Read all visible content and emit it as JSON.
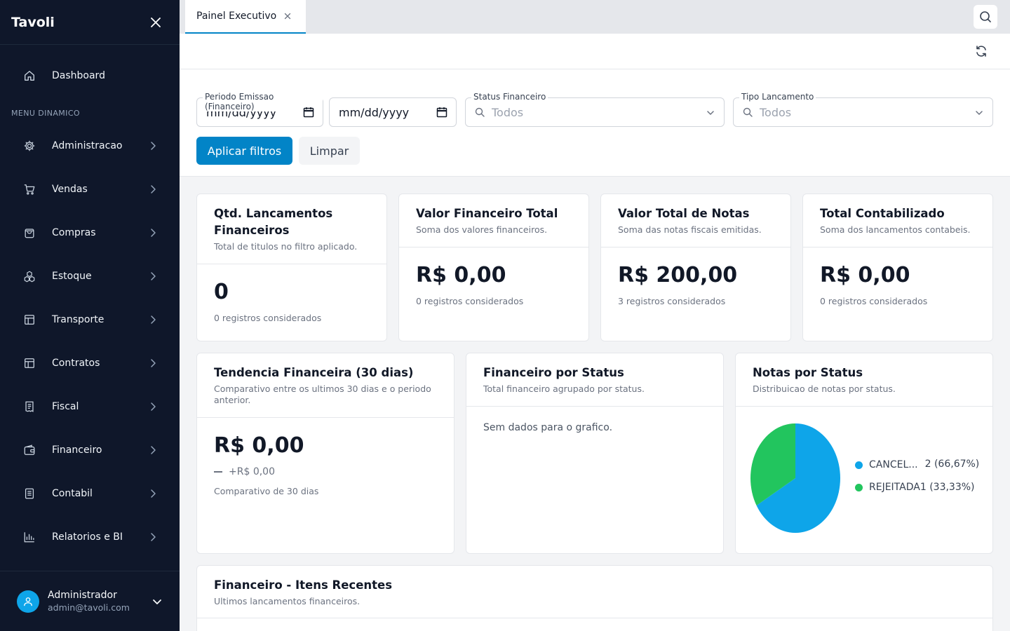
{
  "app": {
    "brand": "Tavoli"
  },
  "sidebar": {
    "dashboard": "Dashboard",
    "section_label": "MENU DINAMICO",
    "items": [
      {
        "label": "Administracao",
        "icon": "gear-icon"
      },
      {
        "label": "Vendas",
        "icon": "cart-icon"
      },
      {
        "label": "Compras",
        "icon": "shopping-bag-icon"
      },
      {
        "label": "Estoque",
        "icon": "boxes-icon"
      },
      {
        "label": "Transporte",
        "icon": "layout-icon"
      },
      {
        "label": "Contratos",
        "icon": "layout-icon"
      },
      {
        "label": "Fiscal",
        "icon": "receipt-icon"
      },
      {
        "label": "Financeiro",
        "icon": "wallet-icon"
      },
      {
        "label": "Contabil",
        "icon": "ledger-icon"
      },
      {
        "label": "Relatorios e BI",
        "icon": "bar-chart-icon"
      }
    ],
    "user": {
      "name": "Administrador",
      "email": "admin@tavoli.com"
    }
  },
  "tabs": [
    {
      "label": "Painel Executivo"
    }
  ],
  "filters": {
    "periodo_label": "Periodo Emissao (Financeiro)",
    "date_start": "mm/dd/yyyy",
    "date_end": "mm/dd/yyyy",
    "status_label": "Status Financeiro",
    "status_value": "Todos",
    "tipo_label": "Tipo Lancamento",
    "tipo_value": "Todos",
    "apply": "Aplicar filtros",
    "clear": "Limpar"
  },
  "kpis": [
    {
      "title": "Qtd. Lancamentos Financeiros",
      "subtitle": "Total de titulos no filtro aplicado.",
      "value": "0",
      "note": "0 registros considerados"
    },
    {
      "title": "Valor Financeiro Total",
      "subtitle": "Soma dos valores financeiros.",
      "value": "R$ 0,00",
      "note": "0 registros considerados"
    },
    {
      "title": "Valor Total de Notas",
      "subtitle": "Soma das notas fiscais emitidas.",
      "value": "R$ 200,00",
      "note": "3 registros considerados"
    },
    {
      "title": "Total Contabilizado",
      "subtitle": "Soma dos lancamentos contabeis.",
      "value": "R$ 0,00",
      "note": "0 registros considerados"
    }
  ],
  "trend": {
    "title": "Tendencia Financeira (30 dias)",
    "subtitle": "Comparativo entre os ultimos 30 dias e o periodo anterior.",
    "value": "R$ 0,00",
    "delta": "+R$ 0,00",
    "note": "Comparativo de 30 dias"
  },
  "status_card": {
    "title": "Financeiro por Status",
    "subtitle": "Total financeiro agrupado por status.",
    "empty": "Sem dados para o grafico."
  },
  "notes_card": {
    "title": "Notas por Status",
    "subtitle": "Distribuicao de notas por status."
  },
  "chart_data": {
    "type": "pie",
    "categories": [
      "CANCEL...",
      "REJEITADA"
    ],
    "values": [
      2,
      1
    ],
    "labels": [
      "2 (66,67%)",
      "1 (33,33%)"
    ],
    "colors": [
      "#0ea5e9",
      "#22c55e"
    ],
    "legend": "right"
  },
  "recent": {
    "title": "Financeiro - Itens Recentes",
    "subtitle": "Ultimos lancamentos financeiros."
  }
}
